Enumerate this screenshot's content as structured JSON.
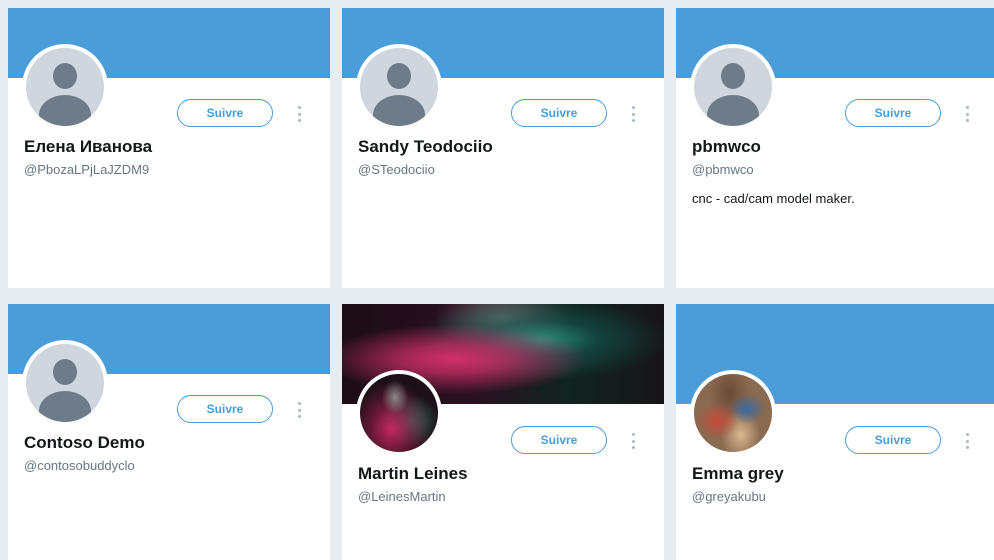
{
  "colors": {
    "banner": "#4a9dd8",
    "accent": "#4a9dd8",
    "page_background": "#e6ecf0"
  },
  "cards": [
    {
      "name": "Елена Иванова",
      "handle": "@PbozaLPjLaJZDM9",
      "bio": "",
      "follow_label": "Suivre",
      "avatar": "default-avatar",
      "banner": "solid-blue"
    },
    {
      "name": "Sandy Teodociio",
      "handle": "@STeodociio",
      "bio": "",
      "follow_label": "Suivre",
      "avatar": "default-avatar",
      "banner": "solid-blue"
    },
    {
      "name": "pbmwco",
      "handle": "@pbmwco",
      "bio": "cnc - cad/cam model maker.",
      "follow_label": "Suivre",
      "avatar": "default-avatar",
      "banner": "solid-blue"
    },
    {
      "name": "Contoso Demo",
      "handle": "@contosobuddyclo",
      "bio": "",
      "follow_label": "Suivre",
      "avatar": "default-avatar",
      "banner": "solid-blue"
    },
    {
      "name": "Martin Leines",
      "handle": "@LeinesMartin",
      "bio": "",
      "follow_label": "Suivre",
      "avatar": "photo",
      "banner": "photo"
    },
    {
      "name": "Emma grey",
      "handle": "@greyakubu",
      "bio": "",
      "follow_label": "Suivre",
      "avatar": "photo",
      "banner": "solid-blue"
    }
  ]
}
